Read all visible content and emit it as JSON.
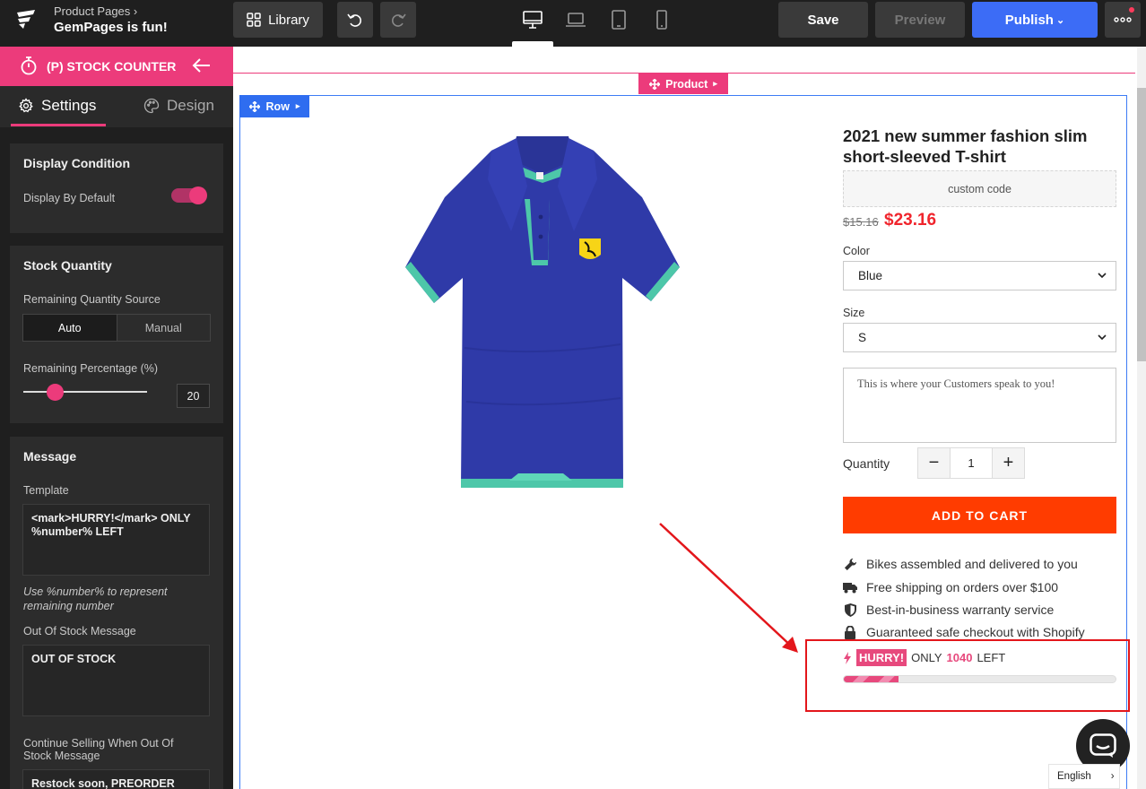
{
  "topbar": {
    "breadcrumb_parent": "Product Pages",
    "page_name": "GemPages is fun!",
    "library_label": "Library",
    "save_label": "Save",
    "preview_label": "Preview",
    "publish_label": "Publish",
    "devices": [
      "desktop",
      "laptop",
      "tablet",
      "mobile"
    ],
    "active_device": "desktop"
  },
  "sidebar": {
    "element_title": "(P) STOCK COUNTER",
    "tabs": [
      {
        "label": "Settings",
        "active": true
      },
      {
        "label": "Design",
        "active": false
      }
    ],
    "display_condition": {
      "heading": "Display Condition",
      "display_by_default_label": "Display By Default",
      "display_by_default": true
    },
    "stock_quantity": {
      "heading": "Stock Quantity",
      "source_label": "Remaining Quantity Source",
      "source_options": [
        "Auto",
        "Manual"
      ],
      "source_selected": "Auto",
      "percentage_label": "Remaining Percentage (%)",
      "percentage_value": "20"
    },
    "message": {
      "heading": "Message",
      "template_label": "Template",
      "template_value": "<mark>HURRY!</mark> ONLY %number% LEFT",
      "template_hint": "Use %number% to represent remaining number",
      "out_of_stock_label": "Out Of Stock Message",
      "out_of_stock_value": "OUT OF STOCK",
      "continue_selling_label": "Continue Selling When Out Of Stock Message",
      "continue_selling_value": "Restock soon, PREORDER"
    }
  },
  "canvas": {
    "product_tag": "Product",
    "row_tag": "Row",
    "product": {
      "title": "2021 new summer fashion slim short-sleeved T-shirt",
      "custom_code": "custom code",
      "compare_price": "$15.16",
      "price": "$23.16",
      "color_label": "Color",
      "color_value": "Blue",
      "size_label": "Size",
      "size_value": "S",
      "message_placeholder": "This is where your Customers speak to you!",
      "quantity_label": "Quantity",
      "quantity_value": "1",
      "add_to_cart": "ADD TO CART",
      "features": [
        {
          "icon": "wrench-icon",
          "text": "Bikes assembled and delivered to you"
        },
        {
          "icon": "truck-icon",
          "text": "Free shipping on orders over $100"
        },
        {
          "icon": "shield-icon",
          "text": "Best-in-business warranty service"
        },
        {
          "icon": "lock-icon",
          "text": "Guaranteed safe checkout with Shopify"
        }
      ],
      "stock_counter": {
        "badge": "HURRY!",
        "prefix": "ONLY",
        "number": "1040",
        "suffix": "LEFT",
        "progress_percent": 20
      }
    },
    "language": "English"
  },
  "colors": {
    "brand_pink": "#ec3b7b",
    "publish_blue": "#3c6cf6",
    "add_to_cart": "#ff3c00",
    "sale_price": "#f0252d",
    "highlight_red": "#e3161b"
  }
}
